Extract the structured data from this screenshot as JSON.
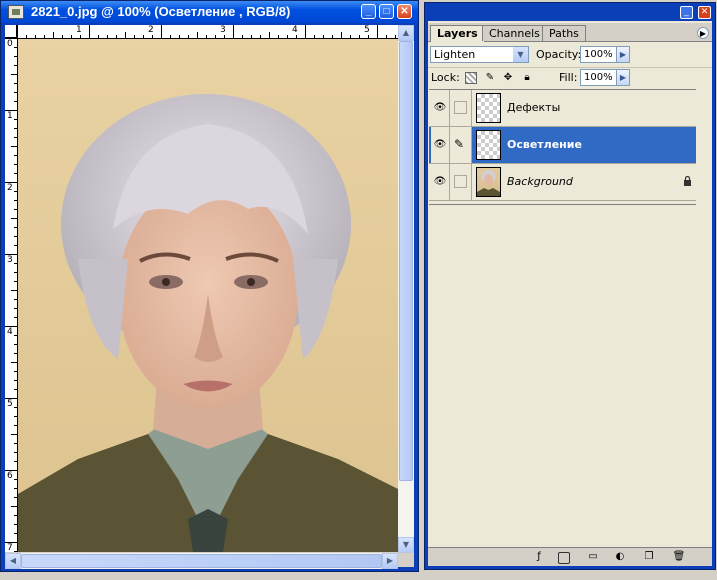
{
  "image_window": {
    "title": "2821_0.jpg @ 100% (Осветление , RGB/8)",
    "controls": {
      "minimize": "_",
      "maximize": "□",
      "close": "✕"
    },
    "ruler_h_labels": [
      "1",
      "2",
      "3",
      "4",
      "5"
    ],
    "ruler_v_labels": [
      "0",
      "1",
      "2",
      "3",
      "4",
      "5",
      "6",
      "7"
    ]
  },
  "layers_palette": {
    "window_controls": {
      "minimize": "_",
      "close": "✕"
    },
    "tabs": [
      {
        "label": "Layers",
        "active": true
      },
      {
        "label": "Channels",
        "active": false
      },
      {
        "label": "Paths",
        "active": false
      }
    ],
    "menu_icon": "palette-menu-icon",
    "blend_mode": "Lighten",
    "opacity_label": "Opacity:",
    "opacity_value": "100%",
    "lock_label": "Lock:",
    "fill_label": "Fill:",
    "fill_value": "100%",
    "layers": [
      {
        "name": "Дефекты",
        "visible": true,
        "active": false,
        "locked": false,
        "thumbnail": "transparent"
      },
      {
        "name": "Осветление",
        "visible": true,
        "active": true,
        "locked": false,
        "thumbnail": "transparent"
      },
      {
        "name": "Background",
        "visible": true,
        "active": false,
        "locked": true,
        "thumbnail": "photo"
      }
    ],
    "bottom_icons": [
      "link-layers-icon",
      "add-style-icon",
      "add-mask-icon",
      "new-group-icon",
      "adjustment-layer-icon",
      "new-layer-icon",
      "delete-layer-icon"
    ]
  },
  "colors": {
    "titlebar": "#0a3fb8",
    "selection": "#316ac5",
    "panel_bg": "#ece9d8"
  }
}
